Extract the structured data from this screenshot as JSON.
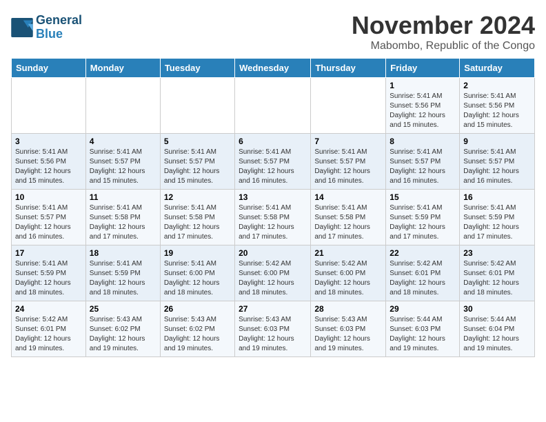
{
  "header": {
    "logo_line1": "General",
    "logo_line2": "Blue",
    "month": "November 2024",
    "location": "Mabombo, Republic of the Congo"
  },
  "weekdays": [
    "Sunday",
    "Monday",
    "Tuesday",
    "Wednesday",
    "Thursday",
    "Friday",
    "Saturday"
  ],
  "weeks": [
    [
      {
        "day": "",
        "info": ""
      },
      {
        "day": "",
        "info": ""
      },
      {
        "day": "",
        "info": ""
      },
      {
        "day": "",
        "info": ""
      },
      {
        "day": "",
        "info": ""
      },
      {
        "day": "1",
        "info": "Sunrise: 5:41 AM\nSunset: 5:56 PM\nDaylight: 12 hours\nand 15 minutes."
      },
      {
        "day": "2",
        "info": "Sunrise: 5:41 AM\nSunset: 5:56 PM\nDaylight: 12 hours\nand 15 minutes."
      }
    ],
    [
      {
        "day": "3",
        "info": "Sunrise: 5:41 AM\nSunset: 5:56 PM\nDaylight: 12 hours\nand 15 minutes."
      },
      {
        "day": "4",
        "info": "Sunrise: 5:41 AM\nSunset: 5:57 PM\nDaylight: 12 hours\nand 15 minutes."
      },
      {
        "day": "5",
        "info": "Sunrise: 5:41 AM\nSunset: 5:57 PM\nDaylight: 12 hours\nand 15 minutes."
      },
      {
        "day": "6",
        "info": "Sunrise: 5:41 AM\nSunset: 5:57 PM\nDaylight: 12 hours\nand 16 minutes."
      },
      {
        "day": "7",
        "info": "Sunrise: 5:41 AM\nSunset: 5:57 PM\nDaylight: 12 hours\nand 16 minutes."
      },
      {
        "day": "8",
        "info": "Sunrise: 5:41 AM\nSunset: 5:57 PM\nDaylight: 12 hours\nand 16 minutes."
      },
      {
        "day": "9",
        "info": "Sunrise: 5:41 AM\nSunset: 5:57 PM\nDaylight: 12 hours\nand 16 minutes."
      }
    ],
    [
      {
        "day": "10",
        "info": "Sunrise: 5:41 AM\nSunset: 5:57 PM\nDaylight: 12 hours\nand 16 minutes."
      },
      {
        "day": "11",
        "info": "Sunrise: 5:41 AM\nSunset: 5:58 PM\nDaylight: 12 hours\nand 17 minutes."
      },
      {
        "day": "12",
        "info": "Sunrise: 5:41 AM\nSunset: 5:58 PM\nDaylight: 12 hours\nand 17 minutes."
      },
      {
        "day": "13",
        "info": "Sunrise: 5:41 AM\nSunset: 5:58 PM\nDaylight: 12 hours\nand 17 minutes."
      },
      {
        "day": "14",
        "info": "Sunrise: 5:41 AM\nSunset: 5:58 PM\nDaylight: 12 hours\nand 17 minutes."
      },
      {
        "day": "15",
        "info": "Sunrise: 5:41 AM\nSunset: 5:59 PM\nDaylight: 12 hours\nand 17 minutes."
      },
      {
        "day": "16",
        "info": "Sunrise: 5:41 AM\nSunset: 5:59 PM\nDaylight: 12 hours\nand 17 minutes."
      }
    ],
    [
      {
        "day": "17",
        "info": "Sunrise: 5:41 AM\nSunset: 5:59 PM\nDaylight: 12 hours\nand 18 minutes."
      },
      {
        "day": "18",
        "info": "Sunrise: 5:41 AM\nSunset: 5:59 PM\nDaylight: 12 hours\nand 18 minutes."
      },
      {
        "day": "19",
        "info": "Sunrise: 5:41 AM\nSunset: 6:00 PM\nDaylight: 12 hours\nand 18 minutes."
      },
      {
        "day": "20",
        "info": "Sunrise: 5:42 AM\nSunset: 6:00 PM\nDaylight: 12 hours\nand 18 minutes."
      },
      {
        "day": "21",
        "info": "Sunrise: 5:42 AM\nSunset: 6:00 PM\nDaylight: 12 hours\nand 18 minutes."
      },
      {
        "day": "22",
        "info": "Sunrise: 5:42 AM\nSunset: 6:01 PM\nDaylight: 12 hours\nand 18 minutes."
      },
      {
        "day": "23",
        "info": "Sunrise: 5:42 AM\nSunset: 6:01 PM\nDaylight: 12 hours\nand 18 minutes."
      }
    ],
    [
      {
        "day": "24",
        "info": "Sunrise: 5:42 AM\nSunset: 6:01 PM\nDaylight: 12 hours\nand 19 minutes."
      },
      {
        "day": "25",
        "info": "Sunrise: 5:43 AM\nSunset: 6:02 PM\nDaylight: 12 hours\nand 19 minutes."
      },
      {
        "day": "26",
        "info": "Sunrise: 5:43 AM\nSunset: 6:02 PM\nDaylight: 12 hours\nand 19 minutes."
      },
      {
        "day": "27",
        "info": "Sunrise: 5:43 AM\nSunset: 6:03 PM\nDaylight: 12 hours\nand 19 minutes."
      },
      {
        "day": "28",
        "info": "Sunrise: 5:43 AM\nSunset: 6:03 PM\nDaylight: 12 hours\nand 19 minutes."
      },
      {
        "day": "29",
        "info": "Sunrise: 5:44 AM\nSunset: 6:03 PM\nDaylight: 12 hours\nand 19 minutes."
      },
      {
        "day": "30",
        "info": "Sunrise: 5:44 AM\nSunset: 6:04 PM\nDaylight: 12 hours\nand 19 minutes."
      }
    ]
  ]
}
